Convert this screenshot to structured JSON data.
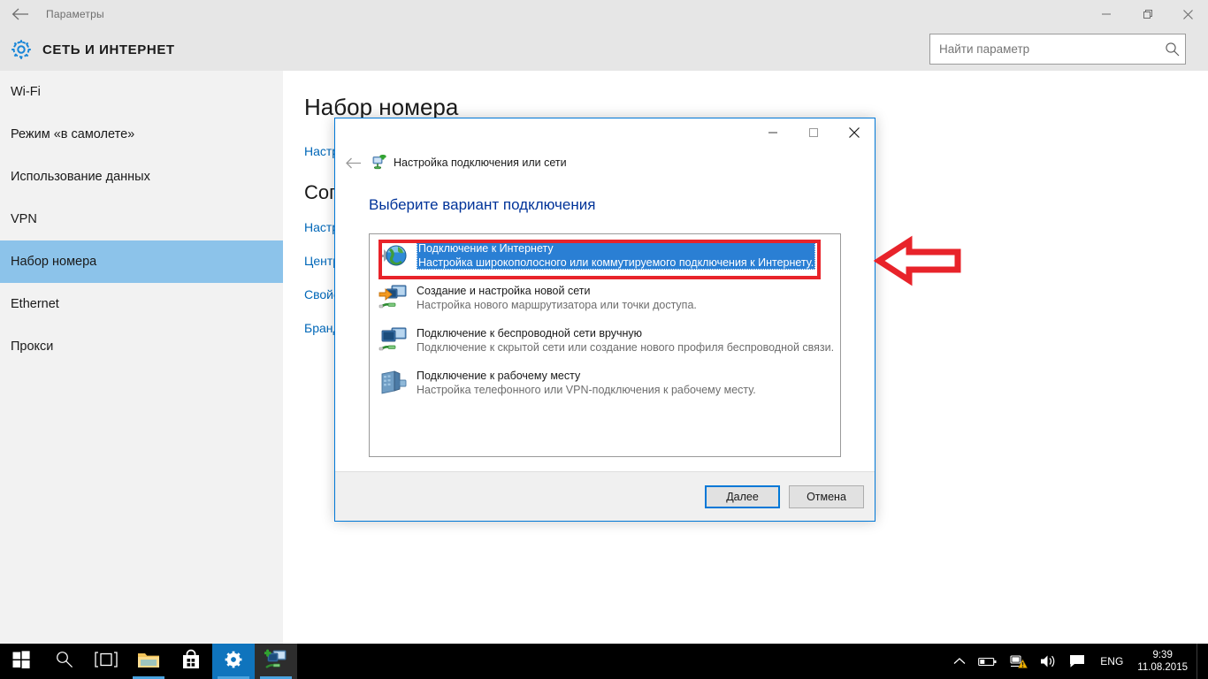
{
  "window": {
    "title": "Параметры",
    "back_icon": "back-arrow-icon",
    "minimize": "—",
    "maximize": "❐",
    "close": "✕"
  },
  "header": {
    "category": "СЕТЬ И ИНТЕРНЕТ",
    "gear_icon": "gear-icon",
    "accent_color": "#0078d7"
  },
  "search": {
    "placeholder": "Найти параметр",
    "value": "",
    "icon": "search-icon"
  },
  "sidebar": {
    "items": [
      {
        "label": "Wi-Fi",
        "active": false
      },
      {
        "label": "Режим «в самолете»",
        "active": false
      },
      {
        "label": "Использование данных",
        "active": false
      },
      {
        "label": "VPN",
        "active": false
      },
      {
        "label": "Набор номера",
        "active": true
      },
      {
        "label": "Ethernet",
        "active": false
      },
      {
        "label": "Прокси",
        "active": false
      }
    ],
    "highlight_color": "#8cc3ea"
  },
  "content": {
    "page_title": "Набор номера",
    "link_1": "Настройка нового подключения",
    "section_title": "Сопутствующие параметры",
    "link_2": "Настройка параметров адаптера",
    "link_3": "Центр управления сетями и общим доступом",
    "link_4": "Свойства браузера",
    "link_5": "Брандмауэр Windows"
  },
  "dialog": {
    "caption": {
      "minimize": "—",
      "maximize": "❐",
      "close": "✕"
    },
    "back_icon": "back-arrow-icon",
    "header_icon": "network-setup-icon",
    "header_title": "Настройка подключения или сети",
    "question": "Выберите вариант подключения",
    "options": [
      {
        "icon": "globe-internet-icon",
        "title": "Подключение к Интернету",
        "desc": "Настройка широкополосного или коммутируемого подключения к Интернету.",
        "selected": true
      },
      {
        "icon": "new-network-icon",
        "title": "Создание и настройка новой сети",
        "desc": "Настройка нового маршрутизатора или точки доступа.",
        "selected": false
      },
      {
        "icon": "wireless-manual-icon",
        "title": "Подключение к беспроводной сети вручную",
        "desc": "Подключение к скрытой сети или создание нового профиля беспроводной связи.",
        "selected": false
      },
      {
        "icon": "workplace-icon",
        "title": "Подключение к рабочему месту",
        "desc": "Настройка телефонного или VPN-подключения к рабочему месту.",
        "selected": false
      }
    ],
    "next_button": "Далее",
    "cancel_button": "Отмена",
    "border_color": "#0078d7",
    "selection_color": "#2a7fd4"
  },
  "annotation": {
    "highlight_color": "#e8232a",
    "box_target": "Подключение к Интернету",
    "arrow_icon": "left-arrow-annotation"
  },
  "taskbar": {
    "items": [
      {
        "name": "start-button",
        "icon": "windows-logo-icon",
        "state": "idle"
      },
      {
        "name": "search-button",
        "icon": "search-icon",
        "state": "idle"
      },
      {
        "name": "task-view-button",
        "icon": "task-view-icon",
        "state": "idle"
      },
      {
        "name": "file-explorer-button",
        "icon": "folder-icon",
        "state": "running"
      },
      {
        "name": "store-button",
        "icon": "store-bag-icon",
        "state": "idle"
      },
      {
        "name": "settings-button",
        "icon": "gear-tile-icon",
        "state": "running"
      },
      {
        "name": "network-setup-button",
        "icon": "network-setup-icon",
        "state": "active"
      }
    ],
    "tray": {
      "chevron": "chevron-up-icon",
      "battery": "battery-icon",
      "network": "network-warning-icon",
      "volume": "volume-icon",
      "action_center": "action-center-icon",
      "language": "ENG",
      "time": "9:39",
      "date": "11.08.2015"
    }
  }
}
